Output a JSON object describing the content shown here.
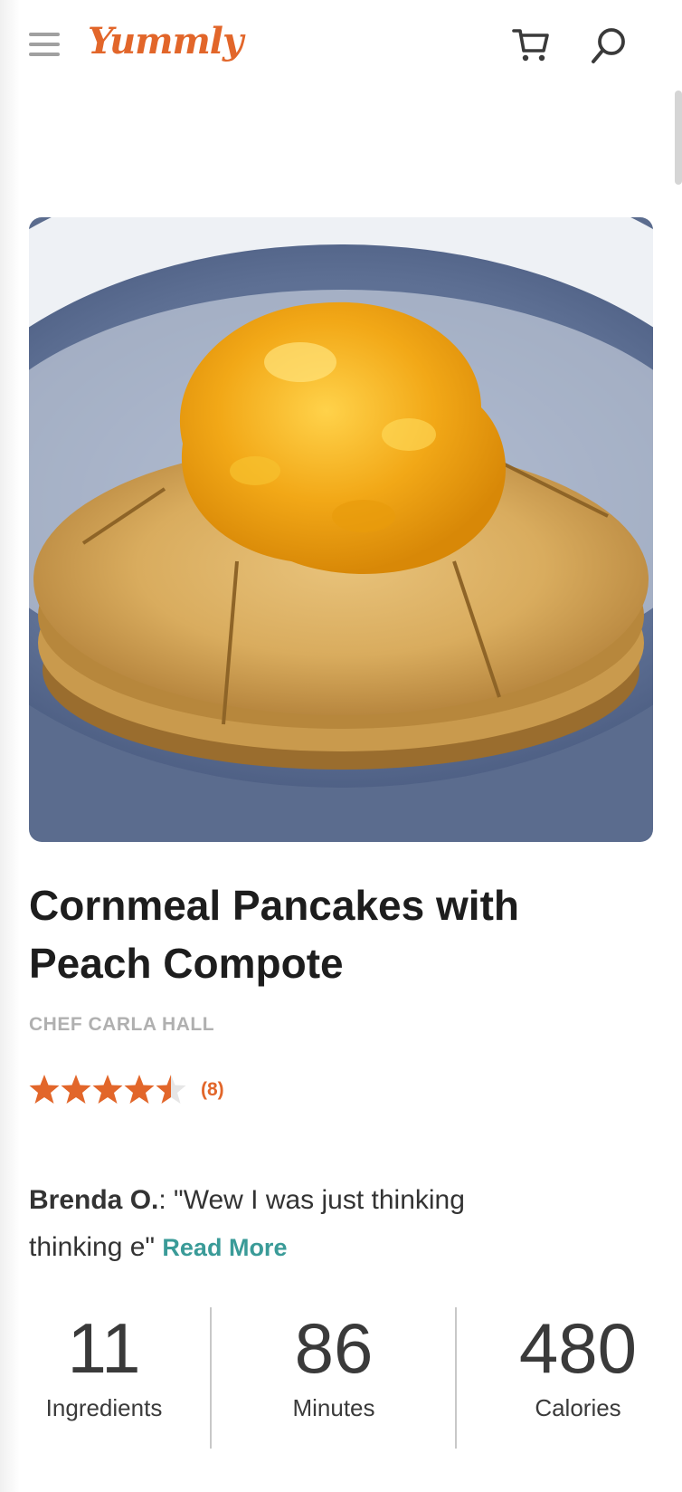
{
  "header": {
    "logo": "Yummly",
    "brand_color": "#e2662a",
    "icons": [
      "menu-icon",
      "cart-icon",
      "search-icon"
    ]
  },
  "recipe": {
    "image_alt": "Cornmeal pancakes topped with peach compote",
    "title": "Cornmeal Pancakes with Peach Compote",
    "chef": "CHEF CARLA HALL",
    "rating": 4.5,
    "rating_max": 5,
    "rating_count": "(8)",
    "review": {
      "author": "Brenda O.",
      "text": ": \"Wew I was just thinking thinking e\"",
      "read_more": "Read More"
    }
  },
  "stats": [
    {
      "value": "11",
      "label": "Ingredients"
    },
    {
      "value": "86",
      "label": "Minutes"
    },
    {
      "value": "480",
      "label": "Calories"
    }
  ]
}
